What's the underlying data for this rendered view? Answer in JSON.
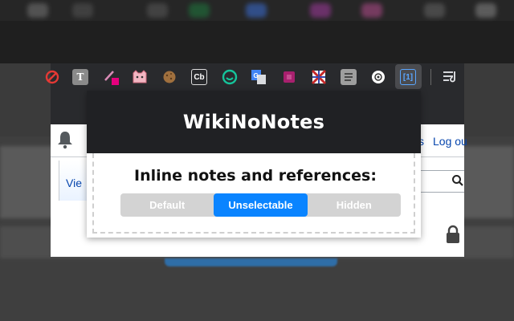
{
  "popup": {
    "title": "WikiNoNotes",
    "label": "Inline notes and references:",
    "options": [
      {
        "label": "Default",
        "selected": false
      },
      {
        "label": "Unselectable",
        "selected": true
      },
      {
        "label": "Hidden",
        "selected": false
      }
    ],
    "accent_color": "#0a84ff"
  },
  "page": {
    "top_links": "s",
    "logout_link": "Log ou",
    "tab_view": "Vie"
  },
  "toolbar": {
    "extensions": [
      "block-icon",
      "text-tool-icon",
      "pen-badge-icon",
      "cat-icon",
      "cookie-icon",
      "cb-icon",
      "grammarly-icon",
      "translate-icon",
      "square-icon",
      "flag-icon",
      "document-icon",
      "circle-icon",
      "wikinonotes-icon"
    ],
    "selected_extension": "wikinonotes-icon",
    "ext_text": {
      "t": "T",
      "cb": "Cb",
      "wnn": "[1]"
    }
  }
}
